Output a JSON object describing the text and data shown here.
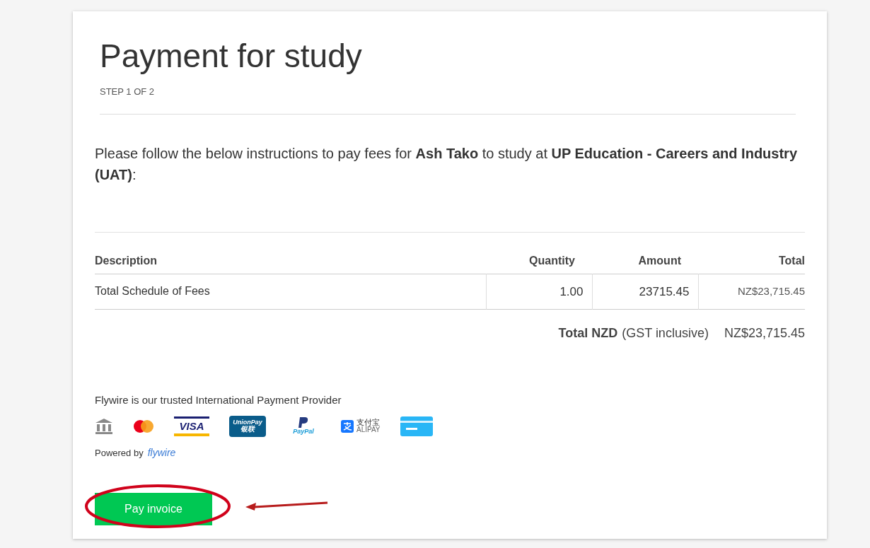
{
  "title": "Payment for study",
  "step": "STEP 1 OF 2",
  "instructions": "Please follow the below instructions to pay fees for **Ash Tako** to study at **UP Education - Careers and Industry (UAT)**:",
  "table": {
    "columns": [
      "Description",
      "Quantity",
      "Amount",
      "Total"
    ],
    "rows": [
      [
        "Total Schedule of Fees",
        "1.00",
        "23715.45",
        "NZ$23,715.45"
      ]
    ]
  },
  "total": {
    "label": "Total NZD",
    "note": "(GST inclusive)",
    "value": "NZ$23,715.45"
  },
  "provider": {
    "text": "Flywire is our trusted International Payment Provider",
    "methods": [
      {
        "kind": "bank"
      },
      {
        "kind": "mastercard"
      },
      {
        "kind": "visa",
        "text": "VISA"
      },
      {
        "kind": "unionpay",
        "text": "UnionPay",
        "subtext": "银联"
      },
      {
        "kind": "paypal",
        "text": "PayPal"
      },
      {
        "kind": "alipay",
        "text": "支付宝",
        "subtext": "ALIPAY"
      },
      {
        "kind": "card"
      }
    ],
    "powered_by": "Powered by",
    "brand": "flywire"
  },
  "button": "Pay invoice"
}
